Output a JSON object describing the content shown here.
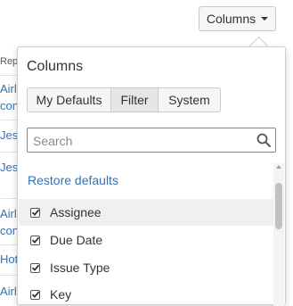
{
  "toolbar": {
    "columns_label": "Columns"
  },
  "background": {
    "header_fragment": "Rep",
    "rows": [
      "Airl",
      "con",
      "Jes",
      "Jes",
      "Airl",
      "con",
      "Hot",
      "Airl"
    ]
  },
  "panel": {
    "title": "Columns",
    "tabs": [
      {
        "label": "My Defaults",
        "active": false
      },
      {
        "label": "Filter",
        "active": true
      },
      {
        "label": "System",
        "active": false
      }
    ],
    "search": {
      "placeholder": "Search",
      "value": ""
    },
    "restore_label": "Restore defaults",
    "items": [
      {
        "label": "Assignee",
        "checked": true,
        "highlighted": true
      },
      {
        "label": "Due Date",
        "checked": true,
        "highlighted": false
      },
      {
        "label": "Issue Type",
        "checked": true,
        "highlighted": false
      },
      {
        "label": "Key",
        "checked": true,
        "highlighted": false
      }
    ]
  },
  "colors": {
    "link": "#3572b0",
    "text": "#333333",
    "border": "#cfcfcf"
  },
  "icons": {
    "search": "search-icon",
    "check": "check-icon",
    "caret": "chevron-down-icon"
  }
}
